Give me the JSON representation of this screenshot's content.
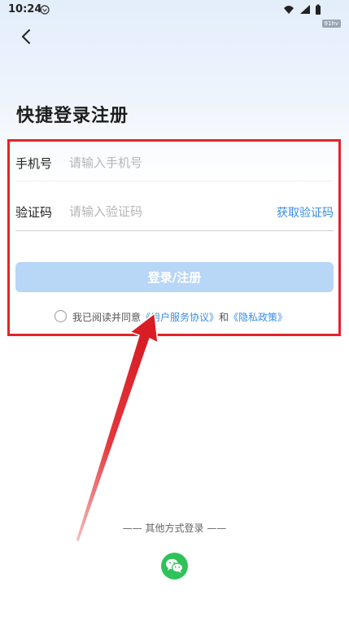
{
  "status_bar": {
    "time": "10:24",
    "watermark": "91hv"
  },
  "page": {
    "title": "快捷登录注册"
  },
  "form": {
    "phone_label": "手机号",
    "phone_placeholder": "请输入手机号",
    "code_label": "验证码",
    "code_placeholder": "请输入验证码",
    "get_code": "获取验证码",
    "submit_label": "登录/注册"
  },
  "agreement": {
    "prefix": "我已阅读并同意",
    "user_agreement": "《用户服务协议》",
    "connector": "和",
    "privacy_policy": "《隐私政策》"
  },
  "other_login": {
    "label": "—— 其他方式登录 ——"
  },
  "colors": {
    "accent": "#3a8ee6",
    "button_disabled": "#b8d6f6",
    "annotation_red": "#e3232b",
    "wechat_green": "#2fc25b"
  }
}
